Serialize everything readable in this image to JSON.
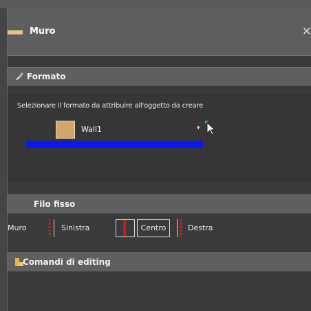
{
  "window": {
    "title": "Muro",
    "close_glyph": "×"
  },
  "sections": {
    "formato": {
      "title": "Formato",
      "icon": "brush-icon",
      "instruction": "Selezionare il formato da attribuire all'oggetto da creare",
      "selected_format": "Wall1",
      "swatch_color": "#d2a66b",
      "accent_bar_color": "#0a18ee"
    },
    "filo_fisso": {
      "title": "Filo fisso",
      "icon": "red-dotted-line-icon",
      "row_label": "Muro",
      "options": {
        "left": "Sinistra",
        "center": "Centro",
        "right": "Destra"
      },
      "selected": "Centro"
    },
    "comandi": {
      "title": "Comandi di editing",
      "icon": "edit-commands-icon"
    }
  }
}
